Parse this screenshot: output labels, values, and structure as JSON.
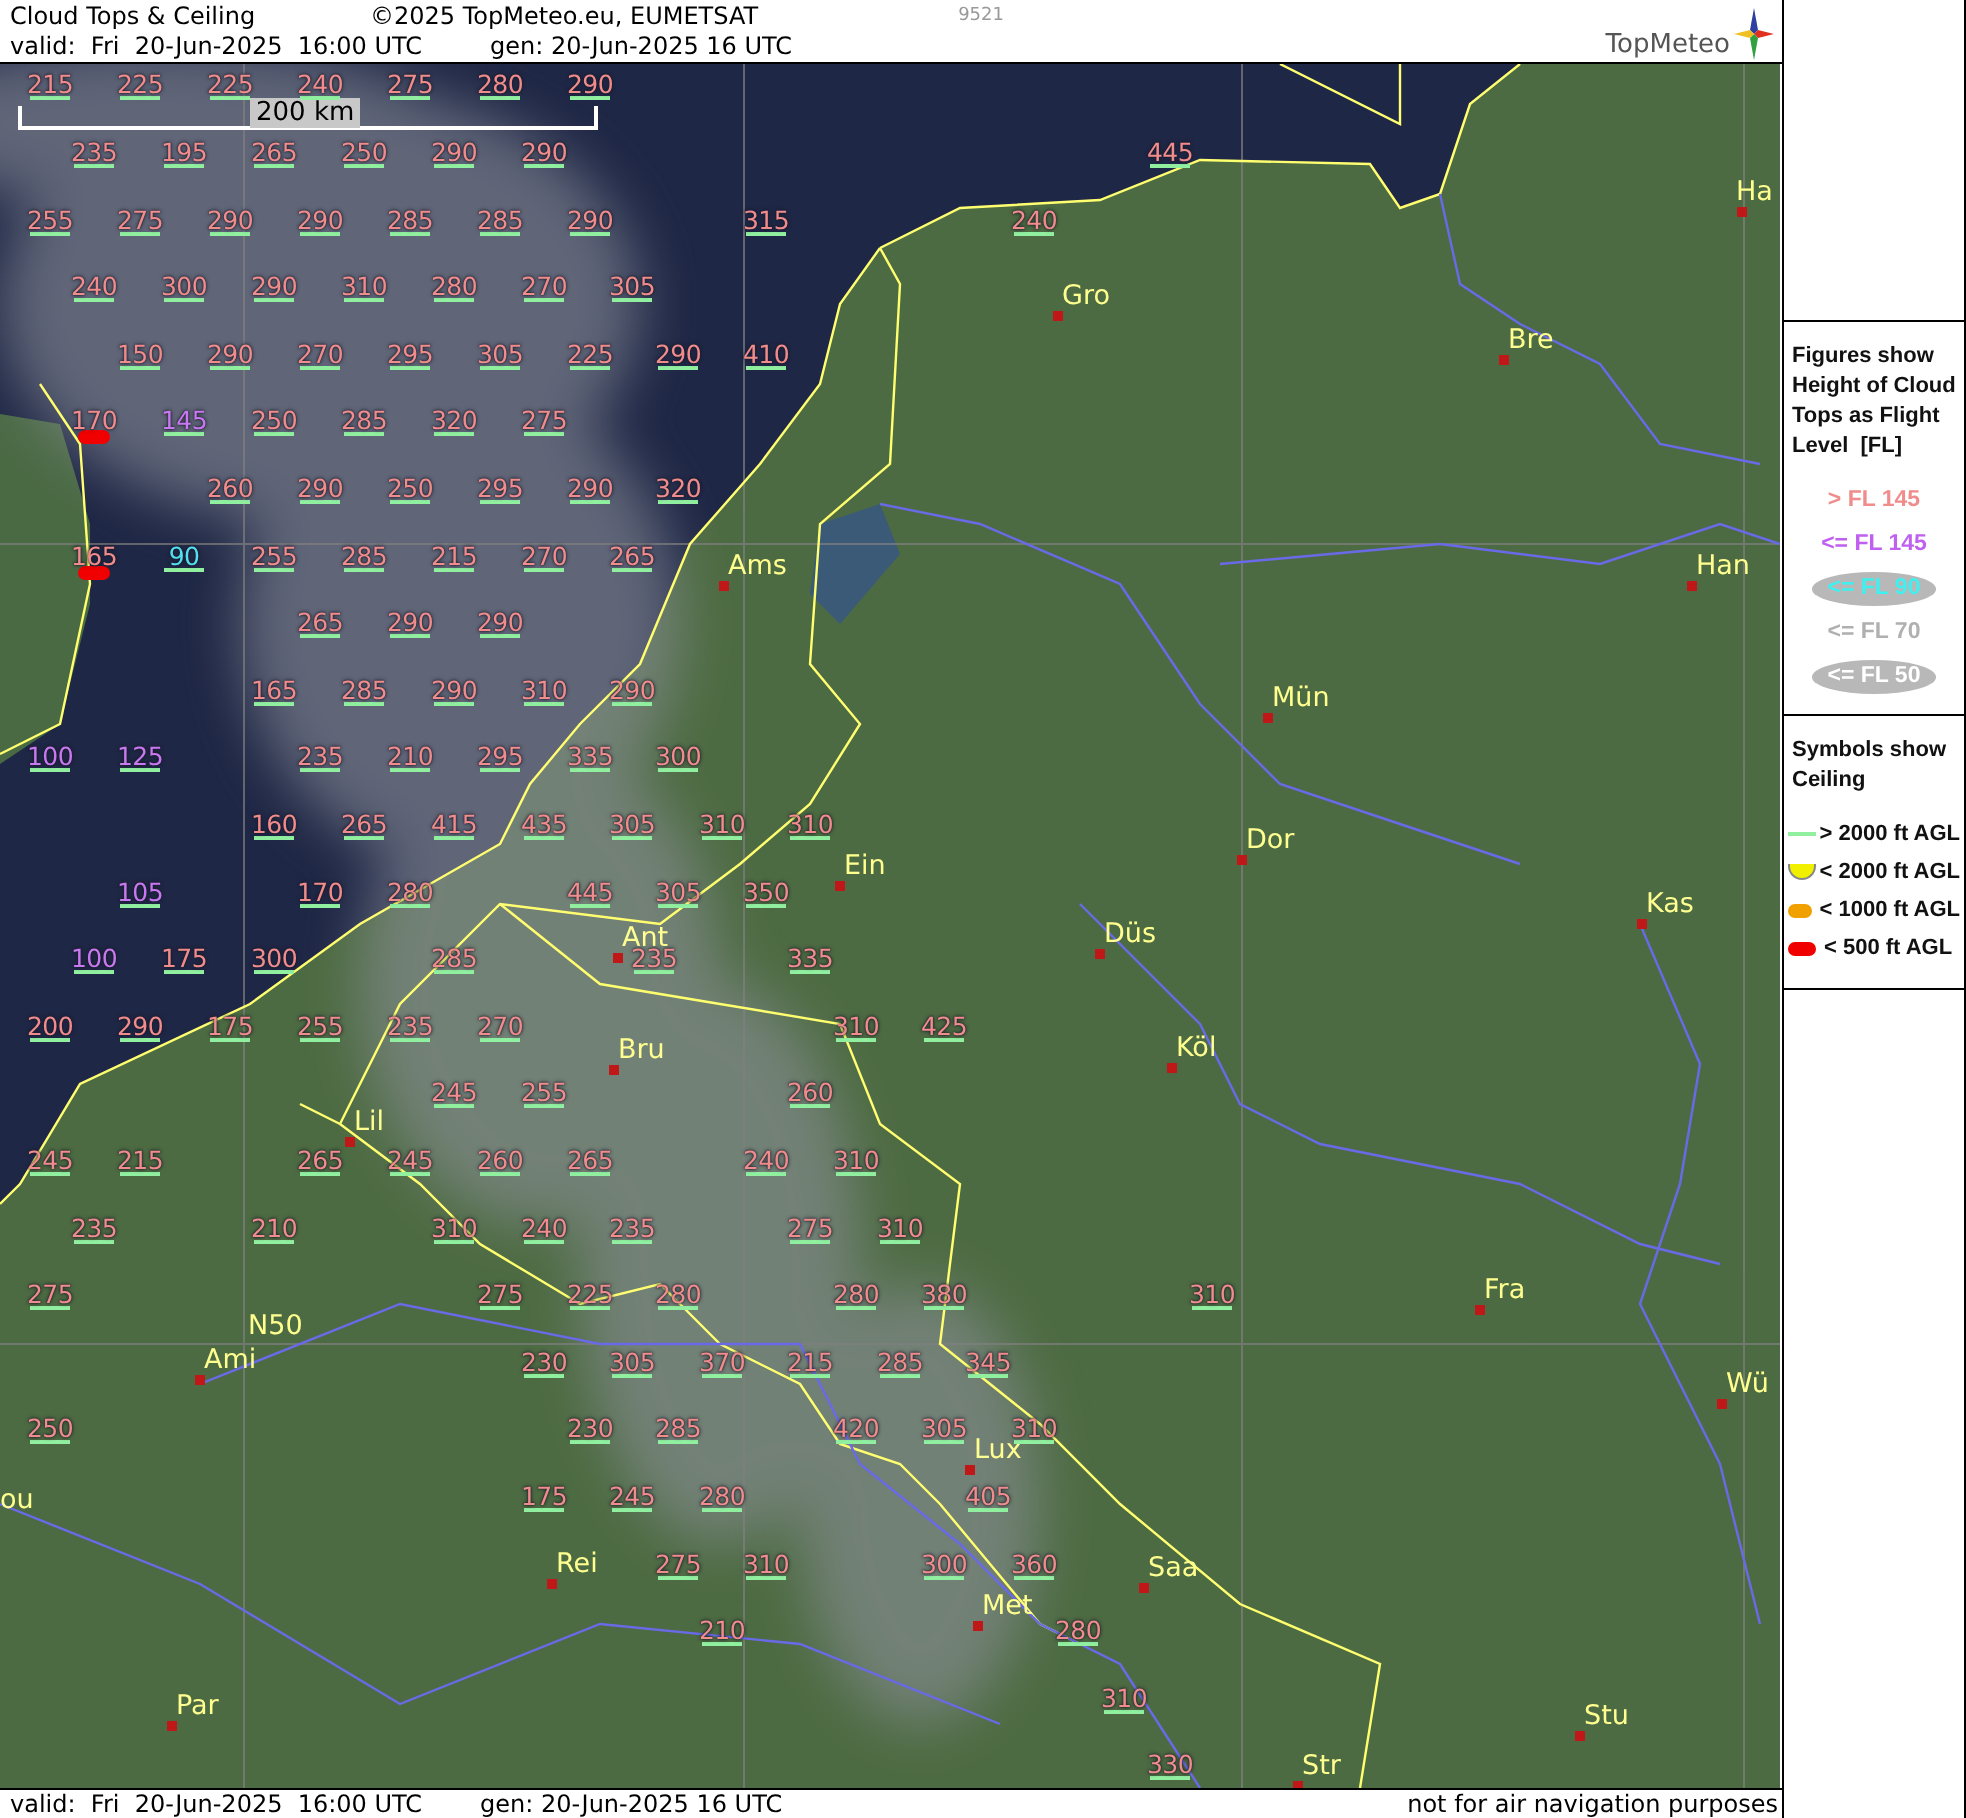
{
  "header": {
    "title": "Cloud Tops & Ceiling",
    "copyright": "©2025 TopMeteo.eu, EUMETSAT",
    "code": "9521",
    "valid": "valid:  Fri  20-Jun-2025  16:00 UTC",
    "generated": "gen: 20-Jun-2025 16 UTC",
    "logo": "TopMeteo"
  },
  "map": {
    "scale_bar": "200 km",
    "figures": [
      {
        "text": "215",
        "color": "#f08c8c",
        "kind": "line"
      },
      {
        "text": "225",
        "color": "#f08c8c",
        "kind": "line"
      },
      {
        "text": "225",
        "color": "#f08c8c",
        "kind": "line"
      },
      {
        "text": "240",
        "color": "#f08c8c",
        "kind": "line"
      },
      {
        "text": "275",
        "color": "#f08c8c",
        "kind": "line"
      },
      {
        "text": "280",
        "color": "#f08c8c",
        "kind": "line"
      },
      {
        "text": "290",
        "color": "#f08c8c",
        "kind": "line"
      },
      {
        "text": "235",
        "color": "#f08c8c",
        "kind": "line"
      },
      {
        "text": "195",
        "color": "#f08c8c",
        "kind": "line"
      },
      {
        "text": "265",
        "color": "#f08c8c",
        "kind": "line"
      },
      {
        "text": "250",
        "color": "#f08c8c",
        "kind": "line"
      },
      {
        "text": "290",
        "color": "#f08c8c",
        "kind": "line"
      },
      {
        "text": "290",
        "color": "#f08c8c",
        "kind": "line"
      },
      {
        "text": "445",
        "color": "#f08c8c",
        "kind": "line"
      },
      {
        "text": "255",
        "color": "#f08c8c",
        "kind": "line"
      },
      {
        "text": "275",
        "color": "#f08c8c",
        "kind": "line"
      },
      {
        "text": "290",
        "color": "#f08c8c",
        "kind": "line"
      },
      {
        "text": "290",
        "color": "#f08c8c",
        "kind": "line"
      },
      {
        "text": "285",
        "color": "#f08c8c",
        "kind": "line"
      },
      {
        "text": "285",
        "color": "#f08c8c",
        "kind": "line"
      },
      {
        "text": "290",
        "color": "#f08c8c",
        "kind": "line"
      },
      {
        "text": "315",
        "color": "#f08c8c",
        "kind": "line"
      },
      {
        "text": "240",
        "color": "#f08c8c",
        "kind": "line"
      },
      {
        "text": "240",
        "color": "#f08c8c",
        "kind": "line"
      },
      {
        "text": "300",
        "color": "#f08c8c",
        "kind": "line"
      },
      {
        "text": "290",
        "color": "#f08c8c",
        "kind": "line"
      },
      {
        "text": "310",
        "color": "#f08c8c",
        "kind": "line"
      },
      {
        "text": "280",
        "color": "#f08c8c",
        "kind": "line"
      },
      {
        "text": "270",
        "color": "#f08c8c",
        "kind": "line"
      },
      {
        "text": "305",
        "color": "#f08c8c",
        "kind": "line"
      },
      {
        "text": "150",
        "color": "#f08c8c",
        "kind": "line"
      },
      {
        "text": "290",
        "color": "#f08c8c",
        "kind": "line"
      },
      {
        "text": "270",
        "color": "#f08c8c",
        "kind": "line"
      },
      {
        "text": "295",
        "color": "#f08c8c",
        "kind": "line"
      },
      {
        "text": "305",
        "color": "#f08c8c",
        "kind": "line"
      },
      {
        "text": "225",
        "color": "#f08c8c",
        "kind": "line"
      },
      {
        "text": "290",
        "color": "#f08c8c",
        "kind": "line"
      },
      {
        "text": "410",
        "color": "#f08c8c",
        "kind": "line"
      },
      {
        "text": "170",
        "color": "#f08c8c",
        "kind": "pill"
      },
      {
        "text": "145",
        "color": "#c878f0",
        "kind": "line"
      },
      {
        "text": "250",
        "color": "#f08c8c",
        "kind": "line"
      },
      {
        "text": "285",
        "color": "#f08c8c",
        "kind": "line"
      },
      {
        "text": "320",
        "color": "#f08c8c",
        "kind": "line"
      },
      {
        "text": "275",
        "color": "#f08c8c",
        "kind": "line"
      },
      {
        "text": "260",
        "color": "#f08c8c",
        "kind": "line"
      },
      {
        "text": "290",
        "color": "#f08c8c",
        "kind": "line"
      },
      {
        "text": "250",
        "color": "#f08c8c",
        "kind": "line"
      },
      {
        "text": "295",
        "color": "#f08c8c",
        "kind": "line"
      },
      {
        "text": "290",
        "color": "#f08c8c",
        "kind": "line"
      },
      {
        "text": "320",
        "color": "#f08c8c",
        "kind": "line"
      },
      {
        "text": "165",
        "color": "#f08c8c",
        "kind": "pill"
      },
      {
        "text": "90",
        "color": "#50e0f0",
        "kind": "line"
      },
      {
        "text": "255",
        "color": "#f08c8c",
        "kind": "line"
      },
      {
        "text": "285",
        "color": "#f08c8c",
        "kind": "line"
      },
      {
        "text": "215",
        "color": "#f08c8c",
        "kind": "line"
      },
      {
        "text": "270",
        "color": "#f08c8c",
        "kind": "line"
      },
      {
        "text": "265",
        "color": "#f08c8c",
        "kind": "line"
      },
      {
        "text": "265",
        "color": "#f08c8c",
        "kind": "line"
      },
      {
        "text": "290",
        "color": "#f08c8c",
        "kind": "line"
      },
      {
        "text": "290",
        "color": "#f08c8c",
        "kind": "line"
      },
      {
        "text": "165",
        "color": "#f08c8c",
        "kind": "line"
      },
      {
        "text": "285",
        "color": "#f08c8c",
        "kind": "line"
      },
      {
        "text": "290",
        "color": "#f08c8c",
        "kind": "line"
      },
      {
        "text": "310",
        "color": "#f08c8c",
        "kind": "line"
      },
      {
        "text": "290",
        "color": "#f08c8c",
        "kind": "line"
      },
      {
        "text": "100",
        "color": "#c878f0",
        "kind": "line"
      },
      {
        "text": "125",
        "color": "#c878f0",
        "kind": "line"
      },
      {
        "text": "235",
        "color": "#f08c8c",
        "kind": "line"
      },
      {
        "text": "210",
        "color": "#f08c8c",
        "kind": "line"
      },
      {
        "text": "295",
        "color": "#f08c8c",
        "kind": "line"
      },
      {
        "text": "335",
        "color": "#f08c8c",
        "kind": "line"
      },
      {
        "text": "300",
        "color": "#f08c8c",
        "kind": "line"
      },
      {
        "text": "160",
        "color": "#f08c8c",
        "kind": "line"
      },
      {
        "text": "265",
        "color": "#f08c8c",
        "kind": "line"
      },
      {
        "text": "415",
        "color": "#f08c8c",
        "kind": "line"
      },
      {
        "text": "435",
        "color": "#f08c8c",
        "kind": "line"
      },
      {
        "text": "305",
        "color": "#f08c8c",
        "kind": "line"
      },
      {
        "text": "310",
        "color": "#f08c8c",
        "kind": "line"
      },
      {
        "text": "310",
        "color": "#f08c8c",
        "kind": "line"
      },
      {
        "text": "105",
        "color": "#c878f0",
        "kind": "line"
      },
      {
        "text": "170",
        "color": "#f08c8c",
        "kind": "line"
      },
      {
        "text": "280",
        "color": "#f08c8c",
        "kind": "line"
      },
      {
        "text": "445",
        "color": "#f08c8c",
        "kind": "line"
      },
      {
        "text": "305",
        "color": "#f08c8c",
        "kind": "line"
      },
      {
        "text": "350",
        "color": "#f08c8c",
        "kind": "line"
      },
      {
        "text": "100",
        "color": "#c878f0",
        "kind": "line"
      },
      {
        "text": "175",
        "color": "#f08c8c",
        "kind": "line"
      },
      {
        "text": "300",
        "color": "#f08c8c",
        "kind": "line"
      },
      {
        "text": "285",
        "color": "#f08c8c",
        "kind": "line"
      },
      {
        "text": "235",
        "color": "#f08c8c",
        "kind": "line"
      },
      {
        "text": "335",
        "color": "#f08c8c",
        "kind": "line"
      },
      {
        "text": "200",
        "color": "#f08c8c",
        "kind": "line"
      },
      {
        "text": "290",
        "color": "#f08c8c",
        "kind": "line"
      },
      {
        "text": "175",
        "color": "#f08c8c",
        "kind": "line"
      },
      {
        "text": "255",
        "color": "#f08c8c",
        "kind": "line"
      },
      {
        "text": "235",
        "color": "#f08c8c",
        "kind": "line"
      },
      {
        "text": "270",
        "color": "#f08c8c",
        "kind": "line"
      },
      {
        "text": "310",
        "color": "#f08c8c",
        "kind": "line"
      },
      {
        "text": "425",
        "color": "#f08c8c",
        "kind": "line"
      },
      {
        "text": "245",
        "color": "#f08c8c",
        "kind": "line"
      },
      {
        "text": "255",
        "color": "#f08c8c",
        "kind": "line"
      },
      {
        "text": "260",
        "color": "#f08c8c",
        "kind": "line"
      },
      {
        "text": "245",
        "color": "#f08c8c",
        "kind": "line"
      },
      {
        "text": "215",
        "color": "#f08c8c",
        "kind": "line"
      },
      {
        "text": "265",
        "color": "#f08c8c",
        "kind": "line"
      },
      {
        "text": "245",
        "color": "#f08c8c",
        "kind": "line"
      },
      {
        "text": "260",
        "color": "#f08c8c",
        "kind": "line"
      },
      {
        "text": "265",
        "color": "#f08c8c",
        "kind": "line"
      },
      {
        "text": "240",
        "color": "#f08c8c",
        "kind": "line"
      },
      {
        "text": "310",
        "color": "#f08c8c",
        "kind": "line"
      },
      {
        "text": "235",
        "color": "#f08c8c",
        "kind": "line"
      },
      {
        "text": "210",
        "color": "#f08c8c",
        "kind": "line"
      },
      {
        "text": "310",
        "color": "#f08c8c",
        "kind": "line"
      },
      {
        "text": "240",
        "color": "#f08c8c",
        "kind": "line"
      },
      {
        "text": "235",
        "color": "#f08c8c",
        "kind": "line"
      },
      {
        "text": "275",
        "color": "#f08c8c",
        "kind": "line"
      },
      {
        "text": "310",
        "color": "#f08c8c",
        "kind": "line"
      },
      {
        "text": "275",
        "color": "#f08c8c",
        "kind": "line"
      },
      {
        "text": "275",
        "color": "#f08c8c",
        "kind": "line"
      },
      {
        "text": "225",
        "color": "#f08c8c",
        "kind": "line"
      },
      {
        "text": "280",
        "color": "#f08c8c",
        "kind": "line"
      },
      {
        "text": "280",
        "color": "#f08c8c",
        "kind": "line"
      },
      {
        "text": "380",
        "color": "#f08c8c",
        "kind": "line"
      },
      {
        "text": "310",
        "color": "#f08c8c",
        "kind": "line"
      },
      {
        "text": "230",
        "color": "#f08c8c",
        "kind": "line"
      },
      {
        "text": "305",
        "color": "#f08c8c",
        "kind": "line"
      },
      {
        "text": "370",
        "color": "#f08c8c",
        "kind": "line"
      },
      {
        "text": "215",
        "color": "#f08c8c",
        "kind": "line"
      },
      {
        "text": "285",
        "color": "#f08c8c",
        "kind": "line"
      },
      {
        "text": "345",
        "color": "#f08c8c",
        "kind": "line"
      },
      {
        "text": "250",
        "color": "#f08c8c",
        "kind": "line"
      },
      {
        "text": "230",
        "color": "#f08c8c",
        "kind": "line"
      },
      {
        "text": "285",
        "color": "#f08c8c",
        "kind": "line"
      },
      {
        "text": "420",
        "color": "#f08c8c",
        "kind": "line"
      },
      {
        "text": "305",
        "color": "#f08c8c",
        "kind": "line"
      },
      {
        "text": "310",
        "color": "#f08c8c",
        "kind": "line"
      },
      {
        "text": "175",
        "color": "#f08c8c",
        "kind": "line"
      },
      {
        "text": "245",
        "color": "#f08c8c",
        "kind": "line"
      },
      {
        "text": "280",
        "color": "#f08c8c",
        "kind": "line"
      },
      {
        "text": "405",
        "color": "#f08c8c",
        "kind": "line"
      },
      {
        "text": "275",
        "color": "#f08c8c",
        "kind": "line"
      },
      {
        "text": "310",
        "color": "#f08c8c",
        "kind": "line"
      },
      {
        "text": "300",
        "color": "#f08c8c",
        "kind": "line"
      },
      {
        "text": "360",
        "color": "#f08c8c",
        "kind": "line"
      },
      {
        "text": "210",
        "color": "#f08c8c",
        "kind": "line"
      },
      {
        "text": "280",
        "color": "#f08c8c",
        "kind": "line"
      },
      {
        "text": "310",
        "color": "#f08c8c",
        "kind": "line"
      },
      {
        "text": "330",
        "color": "#f08c8c",
        "kind": "line"
      }
    ],
    "places": [
      {
        "name": "Ha",
        "kind": "city"
      },
      {
        "name": "Gro",
        "kind": "city"
      },
      {
        "name": "Bre",
        "kind": "city"
      },
      {
        "name": "Ams",
        "kind": "city"
      },
      {
        "name": "Han",
        "kind": "city"
      },
      {
        "name": "Mün",
        "kind": "city"
      },
      {
        "name": "Dor",
        "kind": "city"
      },
      {
        "name": "Ein",
        "kind": "city"
      },
      {
        "name": "Kas",
        "kind": "city"
      },
      {
        "name": "Düs",
        "kind": "city"
      },
      {
        "name": "Ant",
        "kind": "city"
      },
      {
        "name": "Köl",
        "kind": "city"
      },
      {
        "name": "Bru",
        "kind": "city"
      },
      {
        "name": "Lil",
        "kind": "city"
      },
      {
        "name": "Fra",
        "kind": "city"
      },
      {
        "name": "N50",
        "kind": "text"
      },
      {
        "name": "Ami",
        "kind": "city"
      },
      {
        "name": "Wü",
        "kind": "city"
      },
      {
        "name": "Lux",
        "kind": "city"
      },
      {
        "name": "ou",
        "kind": "text"
      },
      {
        "name": "Saa",
        "kind": "city"
      },
      {
        "name": "Rei",
        "kind": "city"
      },
      {
        "name": "Met",
        "kind": "city"
      },
      {
        "name": "Par",
        "kind": "city"
      },
      {
        "name": "Stu",
        "kind": "city"
      },
      {
        "name": "Str",
        "kind": "city"
      }
    ]
  },
  "legend": {
    "figures_title": "Figures show Height of Cloud Tops as Flight Level  [FL]",
    "flight_levels": [
      {
        "label": "> FL 145",
        "color": "#f08c8c",
        "kind": "plain"
      },
      {
        "label": "<= FL 145",
        "color": "#c060f0",
        "kind": "plain"
      },
      {
        "label": "<= FL 90",
        "color": "#40f0f0",
        "kind": "oval"
      },
      {
        "label": "<= FL 70",
        "color": "#b0b0b0",
        "kind": "plain"
      },
      {
        "label": "<= FL 50",
        "color": "#ffffff",
        "kind": "oval"
      }
    ],
    "symbols_title": "Symbols show Ceiling",
    "ceiling_levels": [
      {
        "label": "> 2000 ft AGL",
        "kind": "line",
        "color": "#90f0a0"
      },
      {
        "label": "< 2000 ft AGL",
        "kind": "bowl",
        "color": "#f0f000"
      },
      {
        "label": "< 1000 ft AGL",
        "kind": "pill",
        "color": "#f0a000"
      },
      {
        "label": "< 500 ft AGL",
        "kind": "pill",
        "color": "#f00000"
      }
    ]
  },
  "footer": {
    "valid": "valid:  Fri  20-Jun-2025  16:00 UTC",
    "generated": "gen: 20-Jun-2025 16 UTC",
    "note": "not for air navigation purposes"
  }
}
